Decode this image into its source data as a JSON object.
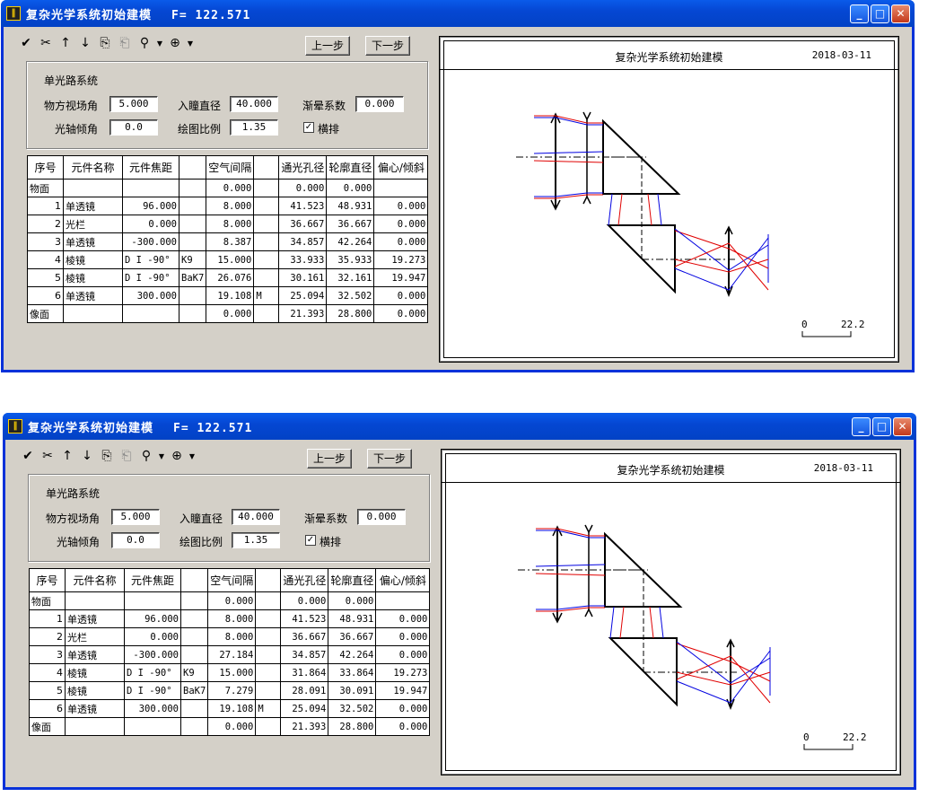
{
  "icons": [
    "check-icon",
    "cut-icon",
    "arrow-up-icon",
    "arrow-down-icon",
    "copy-icon",
    "paste-icon",
    "zoom-out-icon",
    "zoom-in-icon"
  ],
  "windows": [
    {
      "title": "复杂光学系统初始建模",
      "f_label": "F= 122.571",
      "prev": "上一步",
      "next": "下一步",
      "group": "单光路系统",
      "fields": {
        "field_angle_label": "物方视场角",
        "field_angle": "5.000",
        "pupil_label": "入瞳直径",
        "pupil": "40.000",
        "vignette_label": "渐晕系数",
        "vignette": "0.000",
        "tilt_label": "光轴倾角",
        "tilt": "0.0",
        "scale_label": "绘图比例",
        "scale": "1.35",
        "horizontal_label": "横排",
        "horizontal": true
      },
      "headers": [
        "序号",
        "元件名称",
        "元件焦距",
        "",
        "空气间隔",
        "",
        "通光孔径",
        "轮廓直径",
        "偏心/倾斜"
      ],
      "rows": [
        [
          "物面",
          "",
          "",
          "",
          "0.000",
          "",
          "0.000",
          "0.000",
          ""
        ],
        [
          "1",
          "单透镜",
          "96.000",
          "",
          "8.000",
          "",
          "41.523",
          "48.931",
          "0.000"
        ],
        [
          "2",
          "光栏",
          "0.000",
          "",
          "8.000",
          "",
          "36.667",
          "36.667",
          "0.000"
        ],
        [
          "3",
          "单透镜",
          "-300.000",
          "",
          "8.387",
          "",
          "34.857",
          "42.264",
          "0.000"
        ],
        [
          "4",
          "棱镜",
          "D I -90°",
          "K9",
          "15.000",
          "",
          "33.933",
          "35.933",
          "19.273"
        ],
        [
          "5",
          "棱镜",
          "D I -90°",
          "BaK7",
          "26.076",
          "",
          "30.161",
          "32.161",
          "19.947"
        ],
        [
          "6",
          "单透镜",
          "300.000",
          "",
          "19.108",
          "M",
          "25.094",
          "32.502",
          "0.000"
        ],
        [
          "像面",
          "",
          "",
          "",
          "0.000",
          "",
          "21.393",
          "28.800",
          "0.000"
        ]
      ],
      "drawing": {
        "title": "复杂光学系统初始建模",
        "date": "2018-03-11",
        "scale_min": "0",
        "scale_max": "22.2"
      }
    },
    {
      "title": "复杂光学系统初始建模",
      "f_label": "F= 122.571",
      "prev": "上一步",
      "next": "下一步",
      "group": "单光路系统",
      "fields": {
        "field_angle_label": "物方视场角",
        "field_angle": "5.000",
        "pupil_label": "入瞳直径",
        "pupil": "40.000",
        "vignette_label": "渐晕系数",
        "vignette": "0.000",
        "tilt_label": "光轴倾角",
        "tilt": "0.0",
        "scale_label": "绘图比例",
        "scale": "1.35",
        "horizontal_label": "横排",
        "horizontal": true
      },
      "headers": [
        "序号",
        "元件名称",
        "元件焦距",
        "",
        "空气间隔",
        "",
        "通光孔径",
        "轮廓直径",
        "偏心/倾斜"
      ],
      "rows": [
        [
          "物面",
          "",
          "",
          "",
          "0.000",
          "",
          "0.000",
          "0.000",
          ""
        ],
        [
          "1",
          "单透镜",
          "96.000",
          "",
          "8.000",
          "",
          "41.523",
          "48.931",
          "0.000"
        ],
        [
          "2",
          "光栏",
          "0.000",
          "",
          "8.000",
          "",
          "36.667",
          "36.667",
          "0.000"
        ],
        [
          "3",
          "单透镜",
          "-300.000",
          "",
          "27.184",
          "",
          "34.857",
          "42.264",
          "0.000"
        ],
        [
          "4",
          "棱镜",
          "D I -90°",
          "K9",
          "15.000",
          "",
          "31.864",
          "33.864",
          "19.273"
        ],
        [
          "5",
          "棱镜",
          "D I -90°",
          "BaK7",
          "7.279",
          "",
          "28.091",
          "30.091",
          "19.947"
        ],
        [
          "6",
          "单透镜",
          "300.000",
          "",
          "19.108",
          "M",
          "25.094",
          "32.502",
          "0.000"
        ],
        [
          "像面",
          "",
          "",
          "",
          "0.000",
          "",
          "21.393",
          "28.800",
          "0.000"
        ]
      ],
      "drawing": {
        "title": "复杂光学系统初始建模",
        "date": "2018-03-11",
        "scale_min": "0",
        "scale_max": "22.2"
      }
    }
  ],
  "colors": {
    "title_bar": "#0547d3",
    "ray_red": "#e00000",
    "ray_blue": "#0000e0",
    "window_bg": "#d4d0c8"
  }
}
